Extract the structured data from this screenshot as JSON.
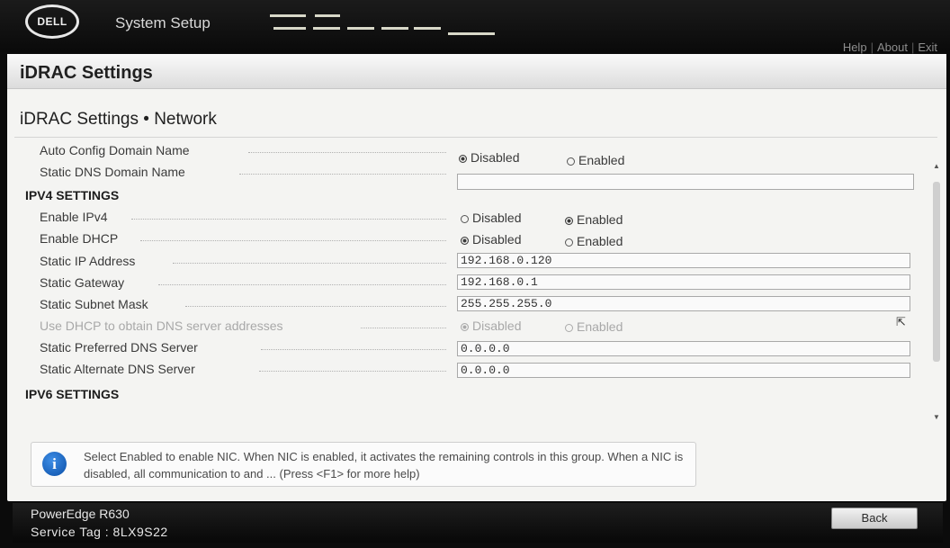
{
  "header": {
    "logo_text": "DELL",
    "app_title": "System Setup",
    "links": {
      "help": "Help",
      "about": "About",
      "exit": "Exit",
      "separator": "|"
    }
  },
  "page": {
    "title": "iDRAC Settings",
    "section_title": "iDRAC Settings • Network"
  },
  "form": {
    "auto_config_domain": {
      "label": "Auto Config Domain Name",
      "options": [
        "Disabled",
        "Enabled"
      ],
      "selected": "Disabled"
    },
    "static_dns_domain": {
      "label": "Static DNS Domain Name",
      "value": ""
    },
    "ipv4_header": "IPV4 SETTINGS",
    "enable_ipv4": {
      "label": "Enable IPv4",
      "options": [
        "Disabled",
        "Enabled"
      ],
      "selected": "Enabled"
    },
    "enable_dhcp": {
      "label": "Enable DHCP",
      "options": [
        "Disabled",
        "Enabled"
      ],
      "selected": "Disabled"
    },
    "static_ip": {
      "label": "Static IP Address",
      "value": "192.168.0.120"
    },
    "static_gateway": {
      "label": "Static Gateway",
      "value": "192.168.0.1"
    },
    "static_subnet": {
      "label": "Static Subnet Mask",
      "value": "255.255.255.0"
    },
    "dhcp_dns": {
      "label": "Use DHCP to obtain DNS server addresses",
      "options": [
        "Disabled",
        "Enabled"
      ],
      "selected": "Disabled",
      "disabled": true
    },
    "pref_dns": {
      "label": "Static Preferred DNS Server",
      "value": "0.0.0.0"
    },
    "alt_dns": {
      "label": "Static Alternate DNS Server",
      "value": "0.0.0.0"
    },
    "ipv6_header": "IPV6 SETTINGS"
  },
  "help": {
    "icon": "info-icon",
    "text": "Select Enabled to enable NIC. When NIC is enabled, it activates the remaining controls in this group. When a NIC is disabled, all communication to and ... (Press <F1> for more help)"
  },
  "footer": {
    "model": "PowerEdge R630",
    "service_tag": "Service Tag : 8LX9S22",
    "back_label": "Back"
  },
  "colors": {
    "header_bg": "#0b0b0b",
    "panel_bg": "#f4f4f2",
    "info_blue": "#0b4fa8"
  }
}
